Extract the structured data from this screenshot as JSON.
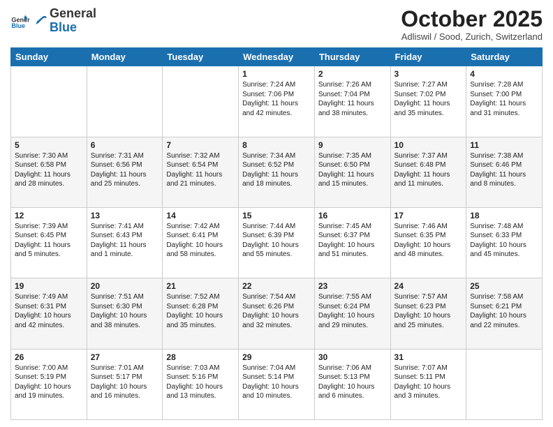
{
  "header": {
    "logo_general": "General",
    "logo_blue": "Blue",
    "month_title": "October 2025",
    "location": "Adliswil / Sood, Zurich, Switzerland"
  },
  "days_of_week": [
    "Sunday",
    "Monday",
    "Tuesday",
    "Wednesday",
    "Thursday",
    "Friday",
    "Saturday"
  ],
  "weeks": [
    [
      {
        "day": "",
        "info": ""
      },
      {
        "day": "",
        "info": ""
      },
      {
        "day": "",
        "info": ""
      },
      {
        "day": "1",
        "info": "Sunrise: 7:24 AM\nSunset: 7:06 PM\nDaylight: 11 hours\nand 42 minutes."
      },
      {
        "day": "2",
        "info": "Sunrise: 7:26 AM\nSunset: 7:04 PM\nDaylight: 11 hours\nand 38 minutes."
      },
      {
        "day": "3",
        "info": "Sunrise: 7:27 AM\nSunset: 7:02 PM\nDaylight: 11 hours\nand 35 minutes."
      },
      {
        "day": "4",
        "info": "Sunrise: 7:28 AM\nSunset: 7:00 PM\nDaylight: 11 hours\nand 31 minutes."
      }
    ],
    [
      {
        "day": "5",
        "info": "Sunrise: 7:30 AM\nSunset: 6:58 PM\nDaylight: 11 hours\nand 28 minutes."
      },
      {
        "day": "6",
        "info": "Sunrise: 7:31 AM\nSunset: 6:56 PM\nDaylight: 11 hours\nand 25 minutes."
      },
      {
        "day": "7",
        "info": "Sunrise: 7:32 AM\nSunset: 6:54 PM\nDaylight: 11 hours\nand 21 minutes."
      },
      {
        "day": "8",
        "info": "Sunrise: 7:34 AM\nSunset: 6:52 PM\nDaylight: 11 hours\nand 18 minutes."
      },
      {
        "day": "9",
        "info": "Sunrise: 7:35 AM\nSunset: 6:50 PM\nDaylight: 11 hours\nand 15 minutes."
      },
      {
        "day": "10",
        "info": "Sunrise: 7:37 AM\nSunset: 6:48 PM\nDaylight: 11 hours\nand 11 minutes."
      },
      {
        "day": "11",
        "info": "Sunrise: 7:38 AM\nSunset: 6:46 PM\nDaylight: 11 hours\nand 8 minutes."
      }
    ],
    [
      {
        "day": "12",
        "info": "Sunrise: 7:39 AM\nSunset: 6:45 PM\nDaylight: 11 hours\nand 5 minutes."
      },
      {
        "day": "13",
        "info": "Sunrise: 7:41 AM\nSunset: 6:43 PM\nDaylight: 11 hours\nand 1 minute."
      },
      {
        "day": "14",
        "info": "Sunrise: 7:42 AM\nSunset: 6:41 PM\nDaylight: 10 hours\nand 58 minutes."
      },
      {
        "day": "15",
        "info": "Sunrise: 7:44 AM\nSunset: 6:39 PM\nDaylight: 10 hours\nand 55 minutes."
      },
      {
        "day": "16",
        "info": "Sunrise: 7:45 AM\nSunset: 6:37 PM\nDaylight: 10 hours\nand 51 minutes."
      },
      {
        "day": "17",
        "info": "Sunrise: 7:46 AM\nSunset: 6:35 PM\nDaylight: 10 hours\nand 48 minutes."
      },
      {
        "day": "18",
        "info": "Sunrise: 7:48 AM\nSunset: 6:33 PM\nDaylight: 10 hours\nand 45 minutes."
      }
    ],
    [
      {
        "day": "19",
        "info": "Sunrise: 7:49 AM\nSunset: 6:31 PM\nDaylight: 10 hours\nand 42 minutes."
      },
      {
        "day": "20",
        "info": "Sunrise: 7:51 AM\nSunset: 6:30 PM\nDaylight: 10 hours\nand 38 minutes."
      },
      {
        "day": "21",
        "info": "Sunrise: 7:52 AM\nSunset: 6:28 PM\nDaylight: 10 hours\nand 35 minutes."
      },
      {
        "day": "22",
        "info": "Sunrise: 7:54 AM\nSunset: 6:26 PM\nDaylight: 10 hours\nand 32 minutes."
      },
      {
        "day": "23",
        "info": "Sunrise: 7:55 AM\nSunset: 6:24 PM\nDaylight: 10 hours\nand 29 minutes."
      },
      {
        "day": "24",
        "info": "Sunrise: 7:57 AM\nSunset: 6:23 PM\nDaylight: 10 hours\nand 25 minutes."
      },
      {
        "day": "25",
        "info": "Sunrise: 7:58 AM\nSunset: 6:21 PM\nDaylight: 10 hours\nand 22 minutes."
      }
    ],
    [
      {
        "day": "26",
        "info": "Sunrise: 7:00 AM\nSunset: 5:19 PM\nDaylight: 10 hours\nand 19 minutes."
      },
      {
        "day": "27",
        "info": "Sunrise: 7:01 AM\nSunset: 5:17 PM\nDaylight: 10 hours\nand 16 minutes."
      },
      {
        "day": "28",
        "info": "Sunrise: 7:03 AM\nSunset: 5:16 PM\nDaylight: 10 hours\nand 13 minutes."
      },
      {
        "day": "29",
        "info": "Sunrise: 7:04 AM\nSunset: 5:14 PM\nDaylight: 10 hours\nand 10 minutes."
      },
      {
        "day": "30",
        "info": "Sunrise: 7:06 AM\nSunset: 5:13 PM\nDaylight: 10 hours\nand 6 minutes."
      },
      {
        "day": "31",
        "info": "Sunrise: 7:07 AM\nSunset: 5:11 PM\nDaylight: 10 hours\nand 3 minutes."
      },
      {
        "day": "",
        "info": ""
      }
    ]
  ]
}
